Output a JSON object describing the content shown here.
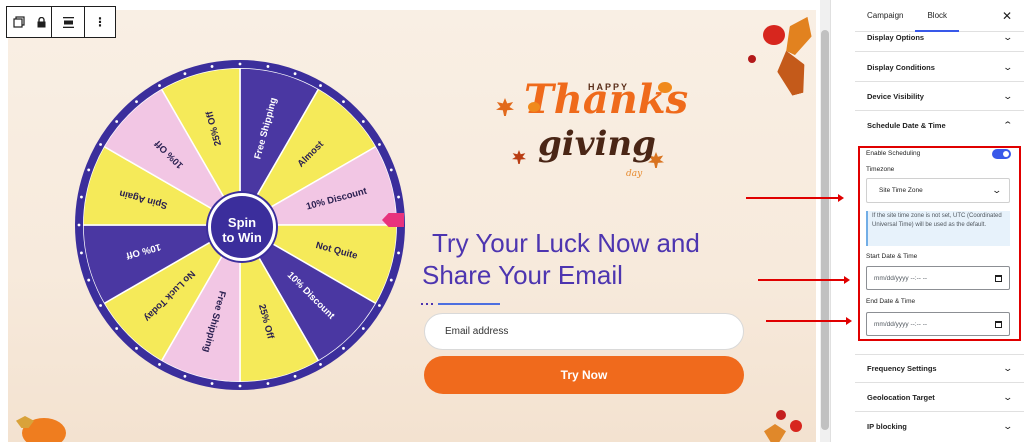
{
  "toolbar": {
    "icons": [
      "block-duplicate-icon",
      "lock-icon",
      "align-icon",
      "more-options-icon"
    ],
    "more_label": "⋮"
  },
  "wheel": {
    "center_label_1": "Spin",
    "center_label_2": "to Win",
    "segments": [
      "Free Shipping",
      "Almost",
      "10% Discount",
      "Not Quite",
      "10% Discount",
      "25% Off",
      "Free Shipping",
      "No Luck Today",
      "10% Off",
      "Spin Again",
      "10% Off",
      "25% Off"
    ],
    "colors": {
      "purple": "#4a37a2",
      "yellow": "#f5ea59",
      "pink": "#f2c6e4",
      "rim": "#3b2e9c",
      "pointer": "#e8337d",
      "hub": "#3b2e9c"
    }
  },
  "hero": {
    "logo_top": "HAPPY",
    "logo_main": "Thanks",
    "logo_sub": "giving",
    "logo_day": "day",
    "headline_1": "Try Your Luck Now and",
    "headline_2": "Share  Your Email",
    "email_placeholder": "Email address",
    "cta_label": "Try Now"
  },
  "sidebar": {
    "tabs": [
      "Campaign",
      "Block"
    ],
    "close": "✕",
    "panels": {
      "display_options": "Display Options",
      "display_conditions": "Display Conditions",
      "device_visibility": "Device Visibility",
      "schedule": "Schedule Date & Time",
      "frequency": "Frequency Settings",
      "geolocation": "Geolocation Target",
      "ip_blocking": "IP blocking"
    },
    "schedule": {
      "enable_label": "Enable Scheduling",
      "enabled": true,
      "timezone_label": "Timezone",
      "timezone_value": "Site Time Zone",
      "note": "If the site time zone is not set, UTC (Coordinated Universal Time) will be used as the default.",
      "start_label": "Start Date & Time",
      "start_value": "mm/dd/yyyy --:-- --",
      "end_label": "End Date & Time",
      "end_value": "mm/dd/yyyy --:-- --"
    },
    "colors": {
      "accent": "#3858e9",
      "highlight": "#e00000"
    }
  }
}
